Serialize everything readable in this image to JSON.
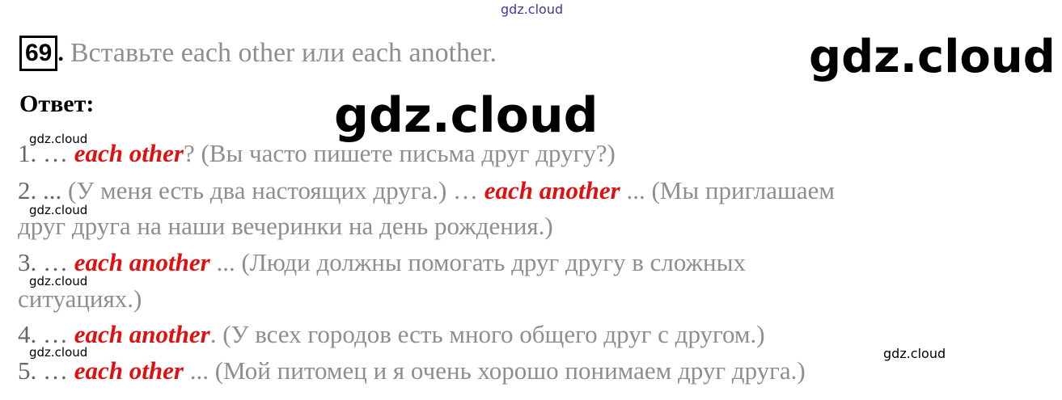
{
  "watermarks": {
    "top": "gdz.cloud",
    "big_right": "gdz.cloud",
    "big_mid": "gdz.cloud",
    "small": [
      "gdz.cloud",
      "gdz.cloud",
      "gdz.cloud",
      "gdz.cloud",
      "gdz.cloud"
    ]
  },
  "task": {
    "number": "69",
    "instruction": "Вставьте each other или each another."
  },
  "answer_heading": "Ответ:",
  "answers": [
    {
      "num": "1. …",
      "answer": "each other",
      "rest": "? (Вы часто пишете письма друг другу?)"
    },
    {
      "num": "2. ...",
      "pre": " (У меня есть два настоящих друга.) … ",
      "answer": "each another",
      "rest": " ... (Мы приглашаем",
      "cont": "друг друга на наши вечеринки на день рождения.)"
    },
    {
      "num": "3. …",
      "answer": "each another",
      "rest": " ... (Люди должны помогать друг другу в сложных",
      "cont": "ситуациях.)"
    },
    {
      "num": "4. …",
      "answer": "each another",
      "rest": ". (У всех городов есть много общего друг с другом.)"
    },
    {
      "num": "5. …",
      "answer": "each other",
      "rest": " ... (Мой питомец и я очень хорошо понимаем друг друга.)"
    }
  ]
}
